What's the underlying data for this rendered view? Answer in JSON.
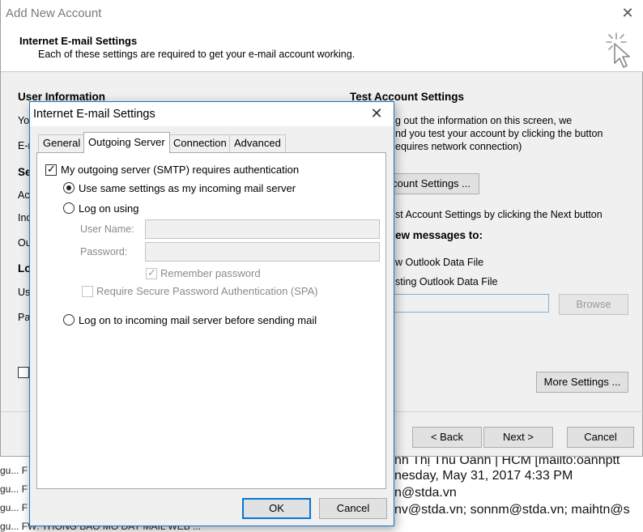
{
  "background_mail": {
    "sender_line": "nh Thị Thu Oanh | HCM [mailto:oanhptt",
    "date_line": "nesday, May 31, 2017 4:33 PM",
    "from_line": "n@stda.vn",
    "to_line": "nv@stda.vn; sonnm@stda.vn; maihtn@s",
    "list_prefix": "gu...",
    "list_col": "F",
    "last_row": "FW: THONG BAO MO DAY MAIL WEB ..."
  },
  "wizard": {
    "title": "Add New Account",
    "header_title": "Internet E-mail Settings",
    "header_subtitle": "Each of these settings are required to get your e-mail account working.",
    "left": {
      "user_info_title": "User Information",
      "row_your_name": "Yo",
      "row_email": "E-r",
      "server_title": "Se",
      "row_account_type": "Ac",
      "row_incoming": "Inc",
      "row_outgoing": "Ou",
      "logon_title": "Lo",
      "row_username": "Us",
      "row_password": "Pa"
    },
    "right": {
      "test_title": "Test Account Settings",
      "test_desc_1": "g out the information on this screen, we",
      "test_desc_2": "nd you test your account by clicking the button",
      "test_desc_3": "equires network connection)",
      "test_button": "count Settings ...",
      "auto_test": "st Account Settings by clicking the Next button",
      "deliver_title": "ew messages to:",
      "radio_new_pst": "w Outlook Data File",
      "radio_existing_pst": "sting Outlook Data File",
      "browse_button": "Browse",
      "more_settings_button": "More Settings ..."
    },
    "buttons": {
      "back": "< Back",
      "next": "Next >",
      "cancel": "Cancel"
    }
  },
  "dialog": {
    "title": "Internet E-mail Settings",
    "tabs": [
      "General",
      "Outgoing Server",
      "Connection",
      "Advanced"
    ],
    "active_tab": "Outgoing Server",
    "smtp_auth_label": "My outgoing server (SMTP) requires authentication",
    "smtp_auth_checked": true,
    "radio_same_settings": "Use same settings as my incoming mail server",
    "radio_logon_using": "Log on using",
    "user_name_label": "User Name:",
    "user_name_value": "",
    "password_label": "Password:",
    "password_value": "",
    "remember_password": "Remember password",
    "remember_password_checked": true,
    "spa_label": "Require Secure Password Authentication (SPA)",
    "spa_checked": false,
    "radio_logon_incoming": "Log on to incoming mail server before sending mail",
    "selected_option": "Use same settings as my incoming mail server",
    "ok_button": "OK",
    "cancel_button": "Cancel"
  },
  "colors": {
    "dialog_border": "#1a73c8",
    "default_button_border": "#0078d7",
    "window_bg": "#f0f0f0"
  }
}
